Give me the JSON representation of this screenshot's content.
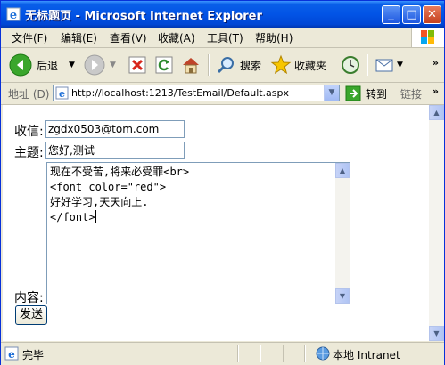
{
  "window": {
    "title": "无标题页 - Microsoft Internet Explorer",
    "minimize": "_",
    "maximize": "□",
    "close": "✕"
  },
  "menu": {
    "items": [
      "文件(F)",
      "编辑(E)",
      "查看(V)",
      "收藏(A)",
      "工具(T)",
      "帮助(H)"
    ]
  },
  "toolbar": {
    "back_label": "后退",
    "search_label": "搜索",
    "favorites_label": "收藏夹"
  },
  "address": {
    "label": "地址 (D)",
    "url": "http://localhost:1213/TestEmail/Default.aspx",
    "go_label": "转到",
    "links_label": "链接"
  },
  "form": {
    "to_label": "收信:",
    "to_value": "zgdx0503@tom.com",
    "subject_label": "主题:",
    "subject_value": "您好,测试",
    "content_label": "内容:",
    "content_lines": [
      "现在不受苦,将来必受罪<br>",
      "<font color=\"red\">",
      "好好学习,天天向上.",
      "</font>"
    ],
    "send_label": "发送"
  },
  "status": {
    "text": "完毕",
    "zone": "本地 Intranet"
  },
  "colors": {
    "titlebar": "#0254e6",
    "chrome": "#ece9d8",
    "border": "#7f9db9"
  }
}
